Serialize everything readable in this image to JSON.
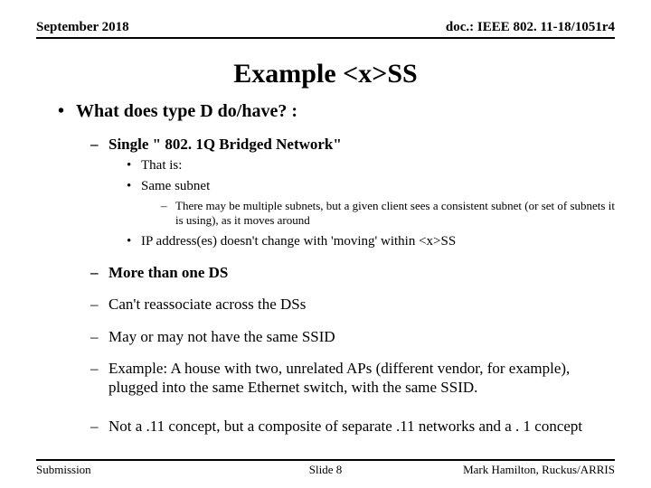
{
  "header": {
    "date": "September 2018",
    "doc": "doc.: IEEE 802. 11-18/1051r4"
  },
  "title": "Example <x>SS",
  "bullets": {
    "q1": "What does type D do/have? :",
    "single_bridged": "Single \" 802. 1Q Bridged Network\"",
    "that_is": "That is:",
    "same_subnet": "Same subnet",
    "multi_subnets": "There may be multiple subnets, but a given client sees a consistent subnet (or set of subnets it is using), as it moves around",
    "ip_no_change": "IP address(es) doesn't change with 'moving' within <x>SS",
    "more_than_one_ds": "More than one DS",
    "cant_reassoc": "Can't reassociate across the DSs",
    "may_ssid": "May or may not have the same SSID",
    "example_house": "Example: A house with two, unrelated APs (different vendor, for example), plugged into the same Ethernet switch, with the same SSID.",
    "not_concept": "Not a .11 concept, but a composite of separate .11 networks and a . 1 concept"
  },
  "footer": {
    "left": "Submission",
    "center": "Slide 8",
    "right": "Mark Hamilton, Ruckus/ARRIS"
  }
}
